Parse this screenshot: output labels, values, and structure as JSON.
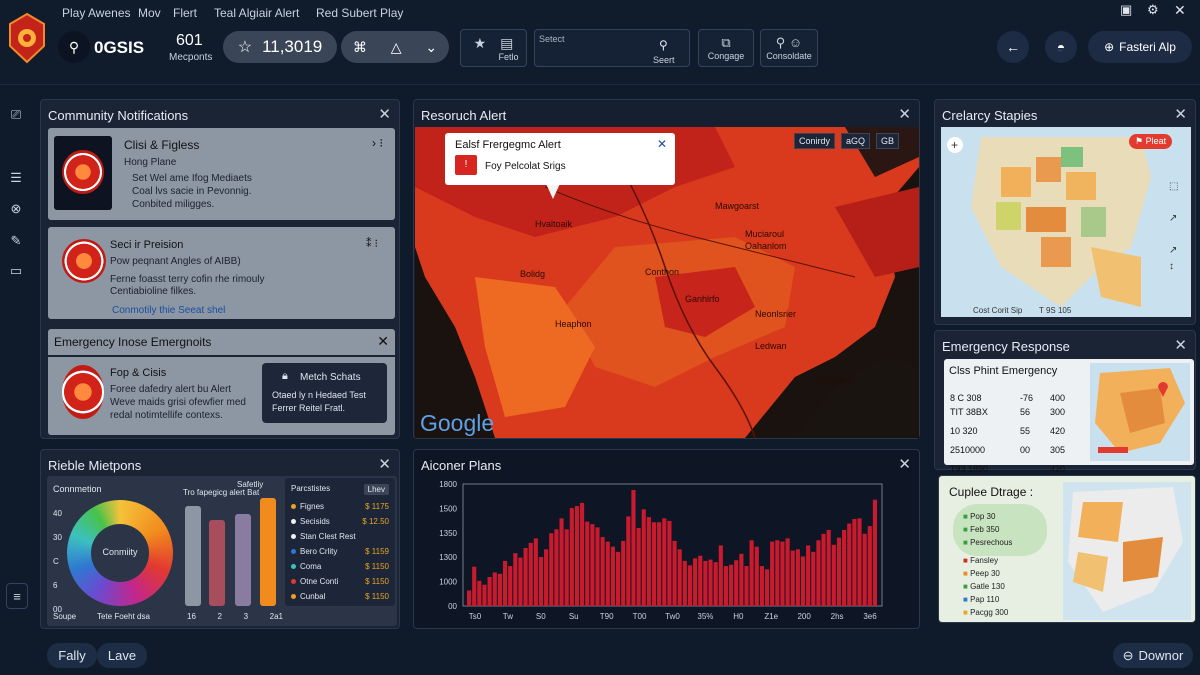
{
  "menu": [
    "Play Awenes",
    "Mov",
    "Flert",
    "Teal Algiair Alert",
    "Red Subert Play"
  ],
  "search": {
    "label": "0GSIS"
  },
  "stat": {
    "value": "601",
    "label": "Mecponts"
  },
  "counter": {
    "value": "11,3019"
  },
  "toolbar": {
    "filter_label": "Fetlo",
    "search_placeholder": "Setect",
    "search_scope": "Seert",
    "congage_label": "Congage",
    "consolidate_label": "Consoldate"
  },
  "account": {
    "button_label": "Fasteri Alp"
  },
  "panels": {
    "community": {
      "title": "Community Notifications",
      "card1": {
        "title": "Clisi & Figless",
        "subtitle": "Hong Plane",
        "lines": [
          "Set Wel ame Ifog Mediaets",
          "Coal lvs sacie in Pevonnig.",
          "Conbited miligges."
        ]
      },
      "card2": {
        "title": "Seci ir Preision",
        "subtitle": "Pow peqnant Angles of AIBB)",
        "lines": [
          "Ferne foasst terry cofin rhe rimouly",
          "Centiabioline filkes."
        ],
        "link": "Conmotily thie Seeat shel"
      }
    },
    "emergency_groups": {
      "title": "Emergency Inose Emergnoits",
      "card": {
        "title": "Fop & Cisis",
        "lines": [
          "Foree dafedry alert bu Alert",
          "Weve maids grisi ofewfier med",
          "redal notimtellife contexs."
        ]
      },
      "match": {
        "title": "Metch Schats",
        "lines": [
          "Otaed ly n Hedaed Test",
          "Ferrer Reitel Fratl."
        ]
      }
    },
    "resource": {
      "title": "Resoruch Alert",
      "popup": {
        "title": "Ealsf Frergegmc Alert",
        "text": "Foy Pelcolat Srigs"
      },
      "map_controls": [
        "Conirdy",
        "aGQ",
        "GB"
      ],
      "map_labels": [
        "Mawgoarst",
        "Muciaroul",
        "Hvaltoaik",
        "Conthon",
        "Bolidg",
        "Oahanlom",
        "Ganhlrfo",
        "Neonlsrier",
        "Heaphon",
        "Ledwan",
        "Wlasarnsn"
      ],
      "brand": "Google"
    },
    "crelarcy": {
      "title": "Crelarcy Stapies",
      "pin": "Pleat",
      "footer": [
        "Cost Corit Sip",
        "T 9S 105"
      ]
    },
    "response": {
      "title": "Emergency Response",
      "table": {
        "title": "Clss Phint Emergency",
        "rows": [
          [
            "8 C 308",
            "-76",
            "400"
          ],
          [
            "TIT 38BX",
            "56",
            "300"
          ],
          [
            "10 320",
            "55",
            "420"
          ],
          [
            "2510000",
            "00",
            "305"
          ],
          [
            "T93 1890",
            "",
            "420"
          ]
        ]
      }
    },
    "cuplee": {
      "title": "Cuplee Dtrage :",
      "tags": [
        "Pop 30",
        "Feb 350",
        "Pesrechous"
      ],
      "legend": [
        {
          "label": "Fansley",
          "color": "#d22a1f"
        },
        {
          "label": "Peep 30",
          "color": "#f28b1d"
        },
        {
          "label": "Gatle 130",
          "color": "#3a9d3f"
        },
        {
          "label": "Pap 110",
          "color": "#2f78d0"
        },
        {
          "label": "Pacgg 300",
          "color": "#e8a423"
        }
      ]
    },
    "rieble": {
      "title": "Rieble Mietpons",
      "donut_title": "Connmetion",
      "donut_center": "Conmiity",
      "donut_axis": [
        "40",
        "30",
        "C",
        "6",
        "00"
      ],
      "bars_title": "Tro fapegicg alert Bat",
      "bars_subtitle": "Safetliy",
      "bars_x": [
        "16",
        "2",
        "3",
        "2a1"
      ],
      "donut_footer": [
        "Soupe",
        "Tete Foeht dsa"
      ],
      "table_header": [
        "Parcstistes",
        "Lhev"
      ],
      "table_rows": [
        {
          "label": "Fignes",
          "value": "$ 1175",
          "color": "#e8a423"
        },
        {
          "label": "Secisids",
          "value": "$ 12.50",
          "color": "#f0f0f0"
        },
        {
          "label": "Stan Clest Rest",
          "value": "",
          "color": "#f0f0f0"
        },
        {
          "label": "Bero Crlity",
          "value": "$ 1159",
          "color": "#2f78d0"
        },
        {
          "label": "Coma",
          "value": "$ 1150",
          "color": "#3cc0c0"
        },
        {
          "label": "Otne Conti",
          "value": "$ 1150",
          "color": "#e03a2f"
        },
        {
          "label": "Cunbal",
          "value": "$ 1150",
          "color": "#f0a020"
        }
      ]
    },
    "aiconer": {
      "title": "Aiconer Plans"
    }
  },
  "chart_data": {
    "type": "bar",
    "title": "Aiconer Plans",
    "ylim": [
      0,
      1800
    ],
    "yticks": [
      "1800",
      "1500",
      "1350",
      "1300",
      "1000",
      "00"
    ],
    "xticks": [
      "Ts0",
      "Tw",
      "S0",
      "Su",
      "T90",
      "T00",
      "Tw0",
      "35%",
      "H0",
      "Z1e",
      "200",
      "2hs",
      "3e6"
    ],
    "values": [
      240,
      610,
      390,
      330,
      450,
      520,
      500,
      700,
      620,
      820,
      750,
      900,
      980,
      1050,
      760,
      880,
      1130,
      1190,
      1360,
      1190,
      1520,
      1550,
      1600,
      1310,
      1270,
      1220,
      1070,
      1000,
      920,
      840,
      1010,
      1390,
      1800,
      1210,
      1500,
      1380,
      1300,
      1300,
      1360,
      1320,
      1010,
      880,
      700,
      630,
      740,
      780,
      700,
      720,
      680,
      940,
      620,
      640,
      710,
      810,
      620,
      1020,
      920,
      620,
      570,
      1000,
      1020,
      1000,
      1050,
      860,
      880,
      770,
      940,
      840,
      1020,
      1120,
      1180,
      950,
      1060,
      1180,
      1280,
      1350,
      1360,
      1120,
      1240,
      1650
    ],
    "color": "#c91a2e"
  },
  "footer": {
    "left1": "Fally",
    "left2": "Lave",
    "right": "Downor"
  },
  "colors": {
    "bg": "#0f1a2b",
    "panel": "#1a2435",
    "accent_red": "#c91a2e"
  }
}
